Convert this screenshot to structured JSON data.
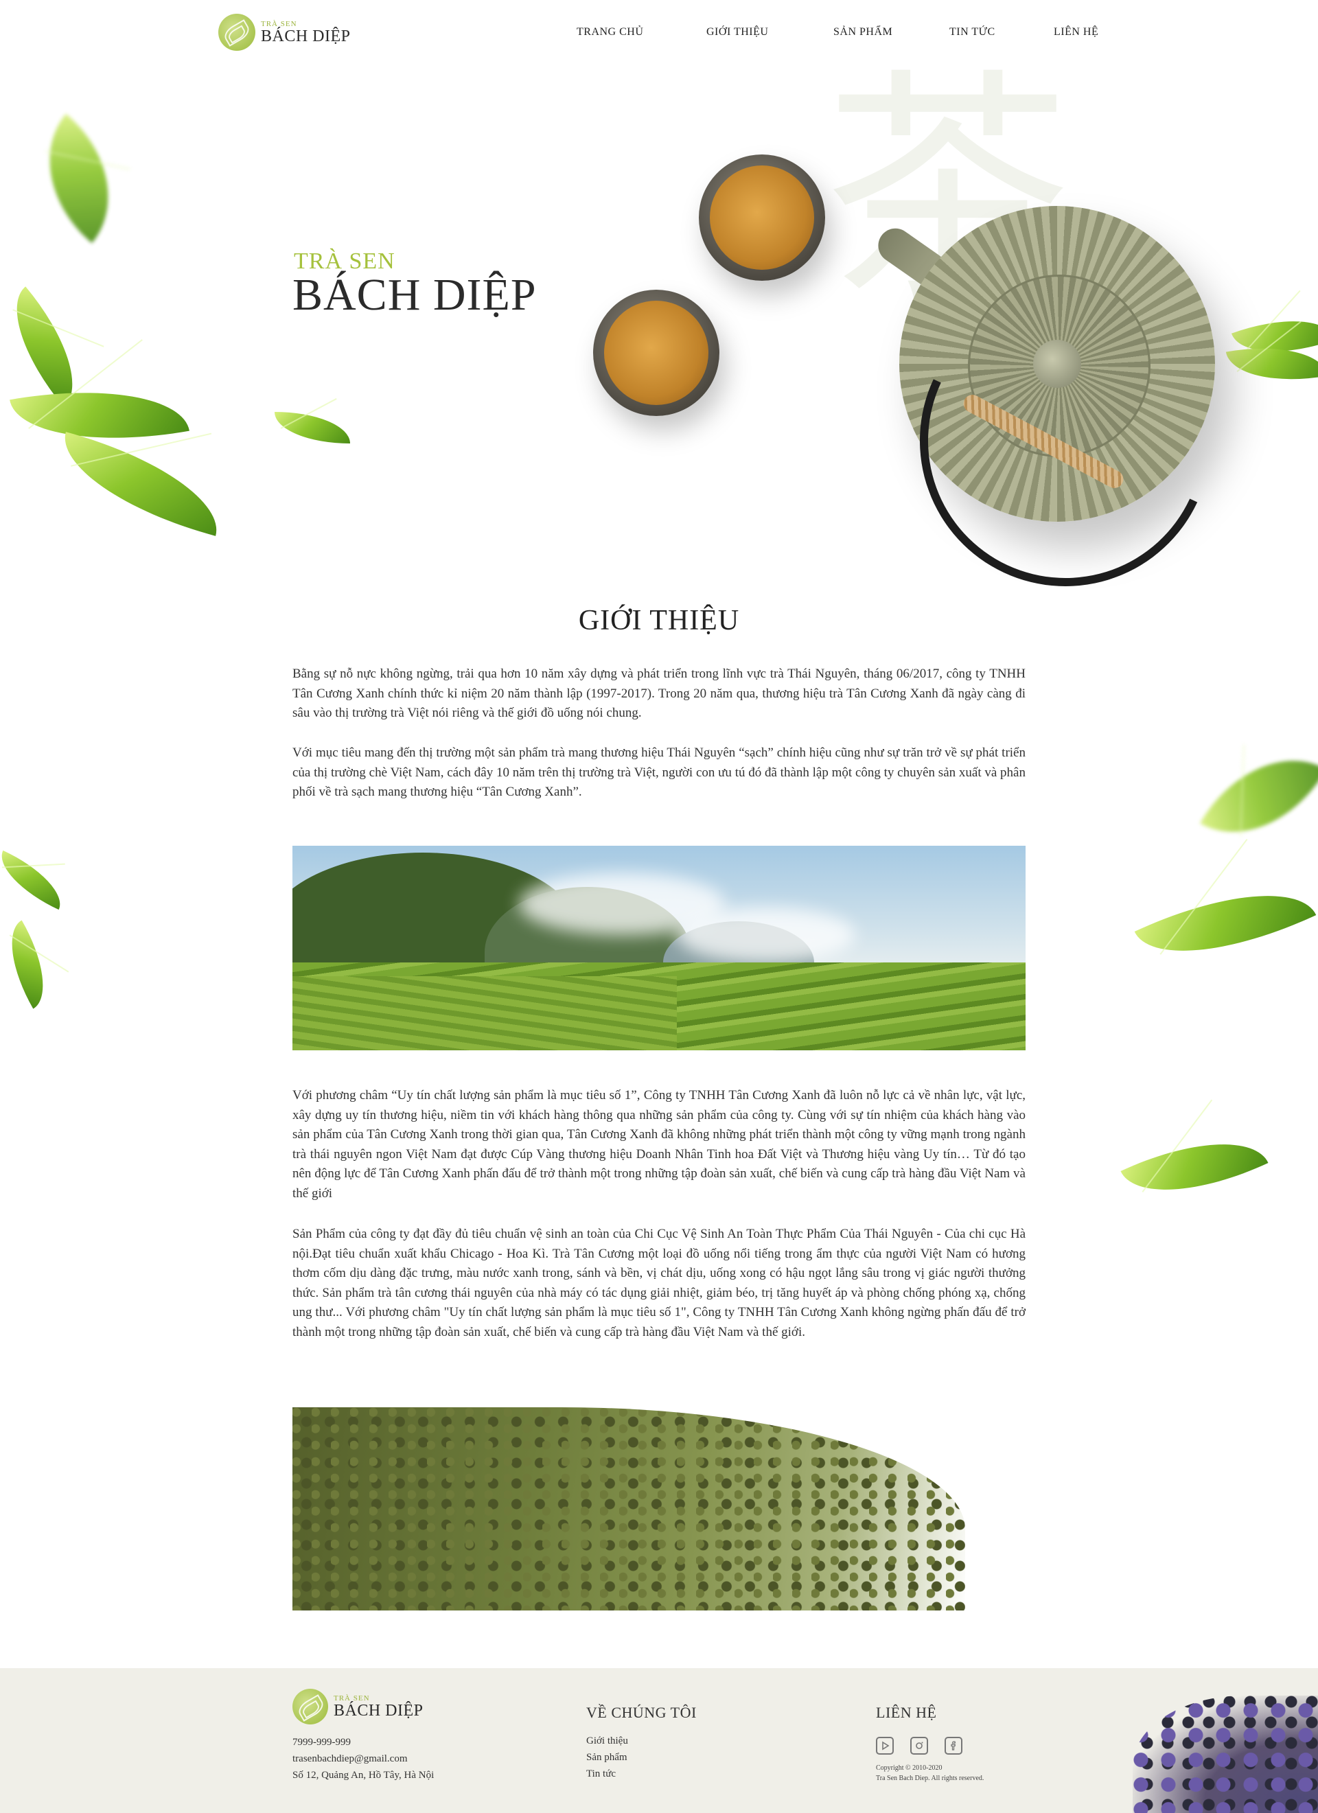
{
  "brand": {
    "small": "TRÀ SEN",
    "big": "BÁCH DIỆP"
  },
  "nav": {
    "items": [
      {
        "label": "TRANG CHỦ"
      },
      {
        "label": "GIỚI THIỆU"
      },
      {
        "label": "SẢN PHẨM"
      },
      {
        "label": "TIN TỨC"
      },
      {
        "label": "LIÊN HỆ"
      }
    ]
  },
  "hero": {
    "subtitle": "TRÀ SEN",
    "title": "BÁCH DIỆP"
  },
  "intro": {
    "heading": "GIỚI THIỆU",
    "paragraphs": [
      "Bằng sự nỗ nực không ngừng, trải qua hơn 10 năm xây dựng và phát triển trong lĩnh vực trà Thái Nguyên, tháng 06/2017, công ty TNHH Tân Cương Xanh chính thức kỉ niệm 20 năm thành lập (1997-2017). Trong 20 năm qua, thương hiệu trà Tân Cương Xanh đã ngày càng đi sâu vào thị trường trà Việt nói riêng và thế giới đồ uống nói chung.",
      "Với mục tiêu mang đến thị trường một sản phẩm trà mang thương hiệu Thái Nguyên “sạch” chính hiệu cũng như sự trăn trở về sự phát triển của thị trường chè Việt Nam, cách đây 10 năm trên thị trường trà Việt, người con ưu tú đó đã thành lập một công ty chuyên sản xuất và phân phối về trà sạch mang thương hiệu “Tân Cương Xanh”.",
      "Với phương châm “Uy tín chất lượng sản phẩm là mục tiêu số 1”, Công ty TNHH Tân Cương Xanh đã luôn nỗ lực cả về nhân lực, vật lực, xây dựng uy tín thương hiệu, niềm tin với khách hàng thông qua những sản phẩm của công ty. Cùng với sự tín nhiệm của khách hàng vào sản phẩm của Tân Cương Xanh trong thời gian qua, Tân Cương Xanh đã không những phát triển thành một công ty vững mạnh trong ngành trà thái nguyên ngon Việt Nam đạt được Cúp Vàng thương hiệu Doanh Nhân Tinh hoa Đất Việt và Thương hiệu vàng Uy tín… Từ đó tạo nên động lực để Tân Cương Xanh phấn đấu để trở thành một trong những tập đoàn sản xuất, chế biến và cung cấp trà hàng đầu Việt Nam và thế giới",
      "Sản Phẩm của công ty đạt đầy đủ tiêu chuẩn vệ sinh an toàn của Chi Cục Vệ Sinh An Toàn Thực Phẩm Của Thái Nguyên - Của chi cục Hà nội.Đạt tiêu chuẩn xuất khẩu Chicago - Hoa Kì. Trà Tân Cương một loại đồ uống nổi tiếng trong ẩm thực của người Việt Nam có hương thơm cốm dịu dàng đặc trưng, màu nước xanh trong, sánh và bền, vị chát dịu, uống xong có hậu ngọt lắng sâu trong vị giác người thưởng thức. Sản phẩm trà tân cương thái nguyên của nhà máy có tác dụng giải nhiệt, giảm béo, trị tăng huyết áp và phòng chống phóng xạ, chống ung thư... Với phương châm \"Uy tín chất lượng sản phẩm là mục tiêu số 1\", Công ty TNHH Tân Cương Xanh không ngừng phấn đấu để trở thành một trong những tập đoàn sản xuất, chế biến và cung cấp trà hàng đầu Việt Nam và thế giới."
    ]
  },
  "footer": {
    "brand_small": "TRÀ SEN",
    "brand_big": "BÁCH DIỆP",
    "phone": "7999-999-999",
    "email": "trasenbachdiep@gmail.com",
    "address": "Số 12, Quảng An, Hồ Tây, Hà Nội",
    "about_heading": "VỀ CHÚNG TÔI",
    "about_links": [
      "Giới thiệu",
      "Sản phẩm",
      "Tin tức"
    ],
    "contact_heading": "LIÊN HỆ",
    "social_icons": [
      "youtube-icon",
      "instagram-icon",
      "facebook-icon"
    ],
    "copyright_1": "Copyright © 2010-2020",
    "copyright_2": "Tra Sen Bach Diep. All rights reserved."
  },
  "colors": {
    "accent": "#a5c13c",
    "text": "#2b2b2b",
    "footer_bg": "#f0efe8"
  }
}
